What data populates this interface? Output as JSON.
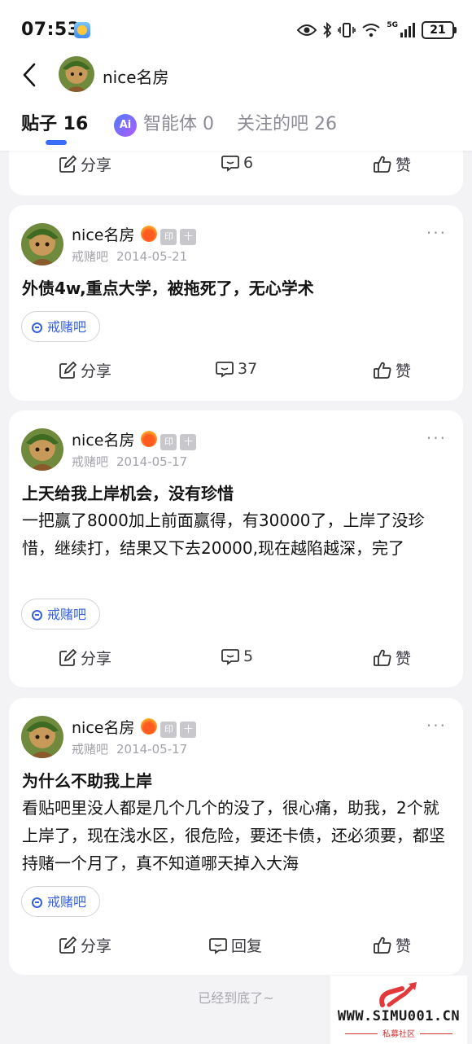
{
  "status": {
    "time": "07:53",
    "battery": "21",
    "net": "5G"
  },
  "header": {
    "username": "nice名房"
  },
  "tabs": [
    {
      "label": "贴子 16"
    },
    {
      "label": "智能体 0",
      "icon_text": "Ai"
    },
    {
      "label": "关注的吧 26"
    }
  ],
  "badges": {
    "yin": "印",
    "plus": "十"
  },
  "top_card": {
    "share": "分享",
    "comments": "6",
    "like": "赞"
  },
  "posts": [
    {
      "author": "nice名房",
      "forum": "戒赌吧",
      "date": "2014-05-21",
      "title": "外债4w,重点大学，被拖死了，无心学术",
      "body": "",
      "tag": "戒赌吧",
      "share": "分享",
      "comments": "37",
      "like": "赞"
    },
    {
      "author": "nice名房",
      "forum": "戒赌吧",
      "date": "2014-05-17",
      "title": "上天给我上岸机会，没有珍惜",
      "body": "一把赢了8000加上前面赢得，有30000了，上岸了没珍惜，继续打，结果又下去20000,现在越陷越深，完了",
      "tag": "戒赌吧",
      "share": "分享",
      "comments": "5",
      "like": "赞"
    },
    {
      "author": "nice名房",
      "forum": "戒赌吧",
      "date": "2014-05-17",
      "title": "为什么不助我上岸",
      "body": "看贴吧里没人都是几个几个的没了，很心痛，助我，2个就上岸了，现在浅水区，很危险，要还卡债，还必须要，都坚持赌一个月了，真不知道哪天掉入大海",
      "tag": "戒赌吧",
      "share": "分享",
      "comments": "回复",
      "like": "赞"
    }
  ],
  "footer": "已经到底了~",
  "watermark": {
    "site": "WWW.SIMU001.CN",
    "sub": "私募社区"
  },
  "colors": {
    "accent": "#3b6cf6",
    "tag": "#3560e0",
    "watermark_red": "#d23232"
  }
}
